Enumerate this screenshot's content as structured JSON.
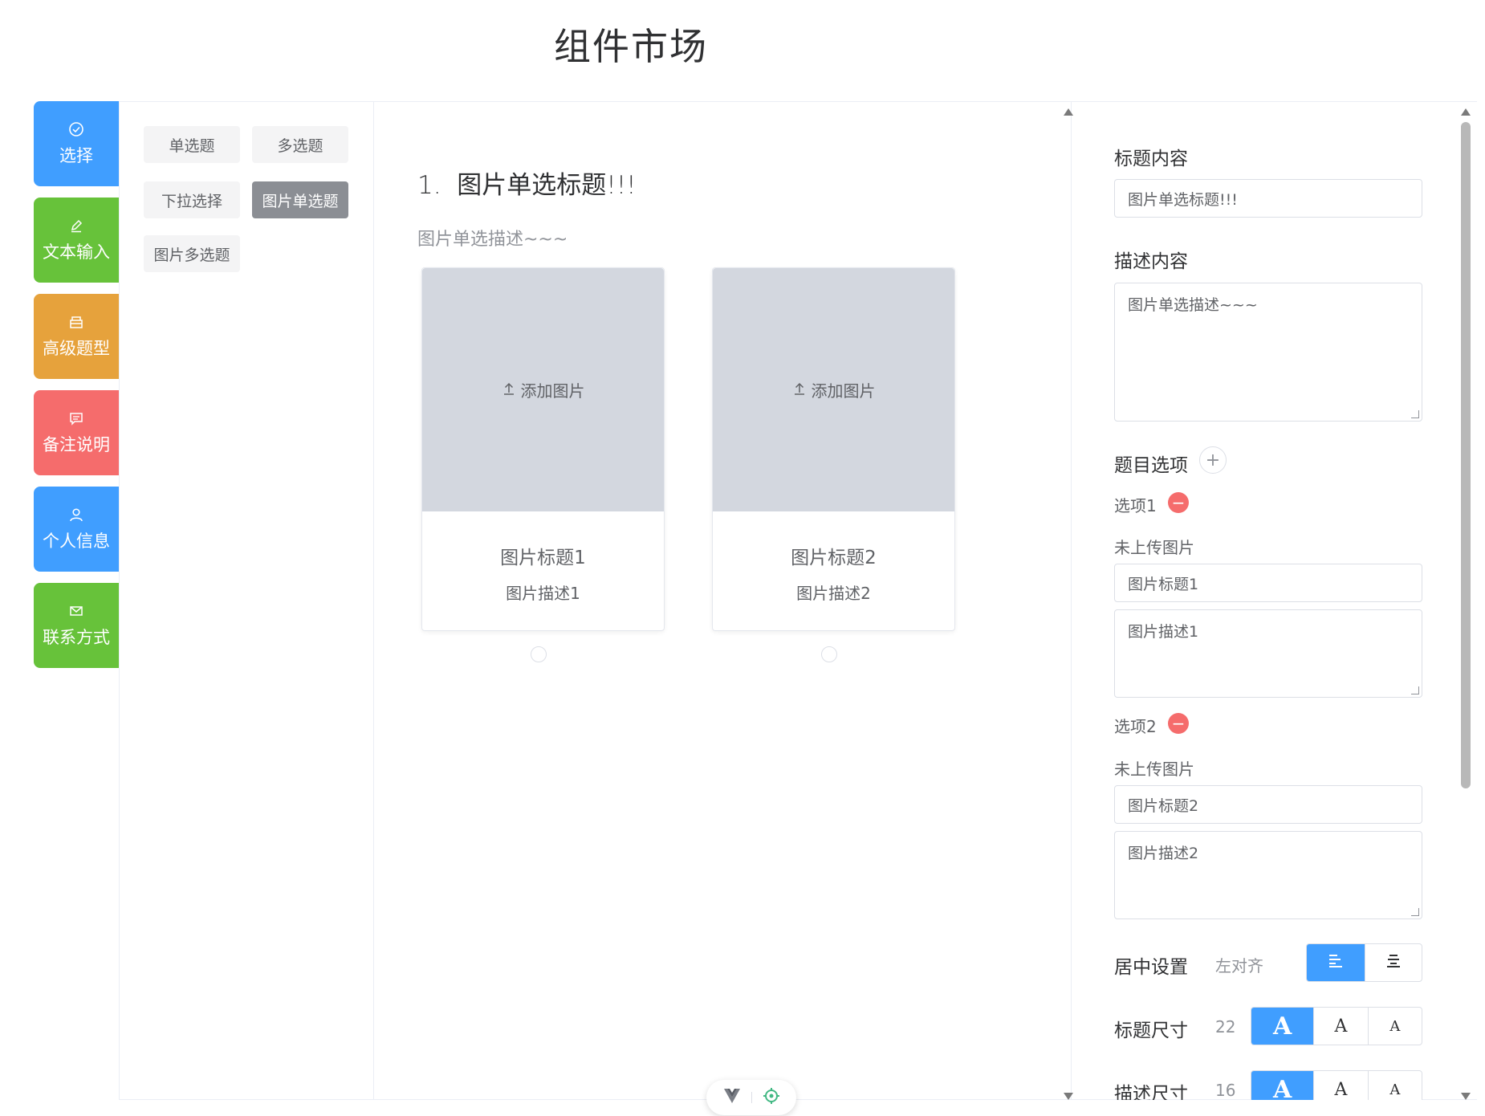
{
  "page": {
    "title": "组件市场"
  },
  "categories": [
    {
      "label": "选择",
      "icon": "check-circle-icon",
      "color": "#409eff"
    },
    {
      "label": "文本输入",
      "icon": "edit-pen-icon",
      "color": "#67c23a"
    },
    {
      "label": "高级题型",
      "icon": "box-icon",
      "color": "#e6a23c"
    },
    {
      "label": "备注说明",
      "icon": "comment-icon",
      "color": "#f56c6c"
    },
    {
      "label": "个人信息",
      "icon": "user-icon",
      "color": "#409eff"
    },
    {
      "label": "联系方式",
      "icon": "mail-icon",
      "color": "#67c23a"
    }
  ],
  "components": [
    {
      "label": "单选题"
    },
    {
      "label": "多选题"
    },
    {
      "label": "下拉选择"
    },
    {
      "label": "图片单选题",
      "active": true
    },
    {
      "label": "图片多选题"
    }
  ],
  "preview": {
    "number": "1.",
    "title": "图片单选标题!!!",
    "description": "图片单选描述~~~",
    "options": [
      {
        "upload_label": "添加图片",
        "title": "图片标题1",
        "description": "图片描述1"
      },
      {
        "upload_label": "添加图片",
        "title": "图片标题2",
        "description": "图片描述2"
      }
    ]
  },
  "settings": {
    "title_label": "标题内容",
    "title_value": "图片单选标题!!!",
    "desc_label": "描述内容",
    "desc_value": "图片单选描述~~~",
    "options_label": "题目选项",
    "options": [
      {
        "label": "选项1",
        "upload_status": "未上传图片",
        "title": "图片标题1",
        "description": "图片描述1"
      },
      {
        "label": "选项2",
        "upload_status": "未上传图片",
        "title": "图片标题2",
        "description": "图片描述2"
      }
    ],
    "align_label": "居中设置",
    "align_value": "左对齐",
    "title_size_label": "标题尺寸",
    "title_size_value": "22",
    "desc_size_label": "描述尺寸",
    "desc_size_value": "16",
    "size_option_glyph": "A"
  }
}
